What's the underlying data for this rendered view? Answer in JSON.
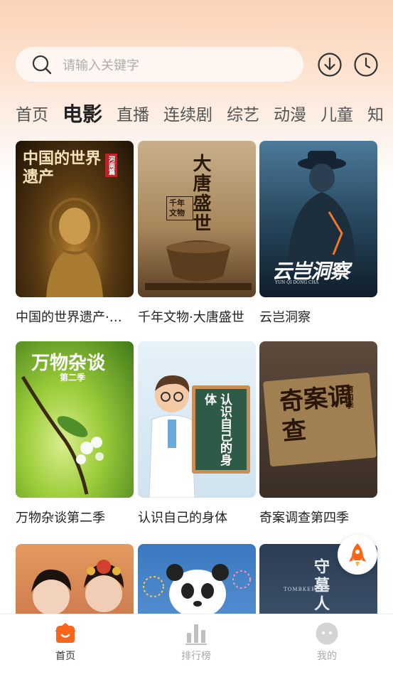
{
  "search": {
    "placeholder": "请输入关键字"
  },
  "header": {
    "download_icon": "download-icon",
    "history_icon": "history-clock-icon"
  },
  "tabs": [
    {
      "label": "首页",
      "active": false
    },
    {
      "label": "电影",
      "active": true
    },
    {
      "label": "直播",
      "active": false
    },
    {
      "label": "连续剧",
      "active": false
    },
    {
      "label": "综艺",
      "active": false
    },
    {
      "label": "动漫",
      "active": false
    },
    {
      "label": "儿童",
      "active": false
    },
    {
      "label": "知",
      "active": false
    }
  ],
  "cards": [
    {
      "title": "中国的世界遗产·河南篇",
      "poster_text": "中国的世界遗产",
      "badge": "河南篇"
    },
    {
      "title": "千年文物·大唐盛世",
      "poster_text": "大唐盛世",
      "badge": "千年文物"
    },
    {
      "title": "云岂洞察",
      "poster_text": "云岂洞察",
      "sub": "YUN QI DONG CHA"
    },
    {
      "title": "万物杂谈第二季",
      "poster_text": "万物杂谈",
      "badge": "第二季"
    },
    {
      "title": "认识自己的身体",
      "poster_text": "认识自己的身体"
    },
    {
      "title": "奇案调查第四季",
      "poster_text": "奇案调查",
      "badge": "第四季"
    },
    {
      "title": "",
      "poster_text": ""
    },
    {
      "title": "",
      "poster_text": ""
    },
    {
      "title": "",
      "poster_text": "守墓人",
      "sub": "TOMBKEEPER"
    }
  ],
  "bottom_nav": [
    {
      "label": "首页",
      "icon": "home-icon",
      "active": true
    },
    {
      "label": "排行榜",
      "icon": "ranking-icon",
      "active": false
    },
    {
      "label": "我的",
      "icon": "profile-icon",
      "active": false
    }
  ],
  "colors": {
    "accent": "#f7661b",
    "inactive": "#bfbfbf"
  }
}
